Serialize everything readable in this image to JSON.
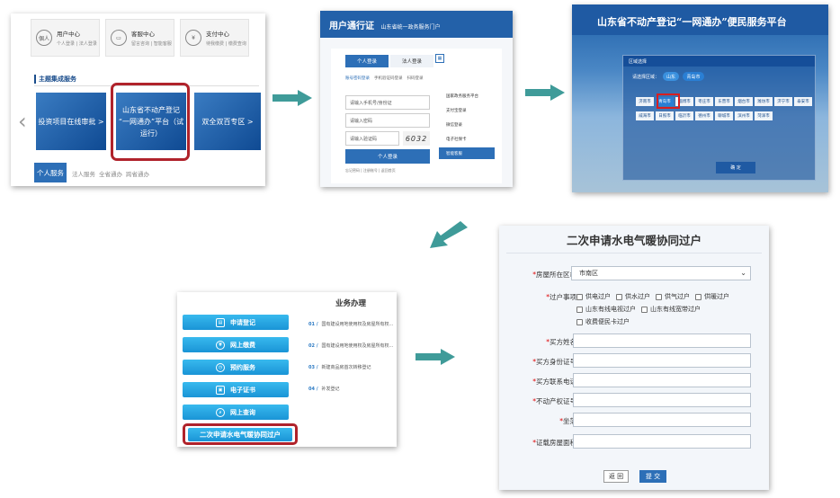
{
  "step1": {
    "services": [
      {
        "icon": "個人",
        "title": "用户中心",
        "sub": "个人登录 | 法人登录"
      },
      {
        "icon": "",
        "title": "客服中心",
        "sub": "留言咨询 | 智能客服"
      },
      {
        "icon": "¥",
        "title": "支付中心",
        "sub": "待我缴费 | 缴费查询"
      }
    ],
    "theme_title": "主题集成服务",
    "banners": [
      "投资项目在线审批 >",
      "山东省不动产登记\n“一网通办”平台（试运行）",
      "双全双百专区 >"
    ],
    "tabs": [
      "个人服务",
      "法人服务",
      "全省通办",
      "跨省通办"
    ]
  },
  "step2": {
    "title": "用户通行证",
    "subtitle": "山东省统一政务服务门户",
    "tabs": [
      "个人登录",
      "法人登录"
    ],
    "sub_tabs": [
      "账号密码登录",
      "手机验证码登录",
      "扫码登录"
    ],
    "fields": [
      "请输入手机号/身份证",
      "请输入密码",
      "请输入验证码"
    ],
    "captcha": "6032",
    "login_button": "个人登录",
    "links": "忘记密码 | 注册账号 | 返回首页",
    "side_options": [
      "国家政务服务平台",
      "支付宝登录",
      "微信登录",
      "电子社保卡",
      "智能客服"
    ]
  },
  "step3": {
    "title": "山东省不动产登记“一网通办”便民服务平台",
    "panel_title": "区域选择",
    "label": "请选择区域：",
    "pills": [
      "山东",
      "青岛市"
    ],
    "cities": [
      "济南市",
      "青岛市",
      "淄博市",
      "枣庄市",
      "东营市",
      "烟台市",
      "潍坊市",
      "济宁市",
      "泰安市",
      "威海市",
      "日照市",
      "临沂市",
      "德州市",
      "聊城市",
      "滨州市",
      "菏泽市"
    ],
    "confirm_button": "确 定"
  },
  "step4": {
    "title": "业务办理",
    "buttons": [
      "申请登记",
      "网上缴费",
      "预约服务",
      "电子证书",
      "网上查询"
    ],
    "button_icons": [
      "▤",
      "¥",
      "◷",
      "▣",
      "⌕"
    ],
    "highlight_button": "二次申请水电气暖协同过户",
    "items": [
      {
        "num": "01 /",
        "text": "国有建设用地使用权及房屋所有权..."
      },
      {
        "num": "02 /",
        "text": "国有建设用地使用权及房屋所有权..."
      },
      {
        "num": "03 /",
        "text": "新建商品房首次转移登记"
      },
      {
        "num": "04 /",
        "text": "补发登记"
      }
    ]
  },
  "step5": {
    "title": "二次申请水电气暖协同过户",
    "district_label": "房屋所在区市",
    "district_value": "市南区",
    "items_label": "过户事项",
    "checkbox_row1": [
      "供电过户",
      "供水过户",
      "供气过户",
      "供暖过户"
    ],
    "checkbox_row2": [
      "山东有线电视过户",
      "山东有线宽带过户"
    ],
    "checkbox_row3": [
      "收费便民卡过户"
    ],
    "fields": [
      "买方姓名",
      "买方身份证号",
      "买方联系电话",
      "不动产权证号",
      "坐落",
      "证载房屋面积"
    ],
    "back_button": "返 回",
    "submit_button": "提 交"
  },
  "colors": {
    "accent": "#2d6fb7",
    "highlight": "#b0232b",
    "arrow": "#3f9b99"
  }
}
